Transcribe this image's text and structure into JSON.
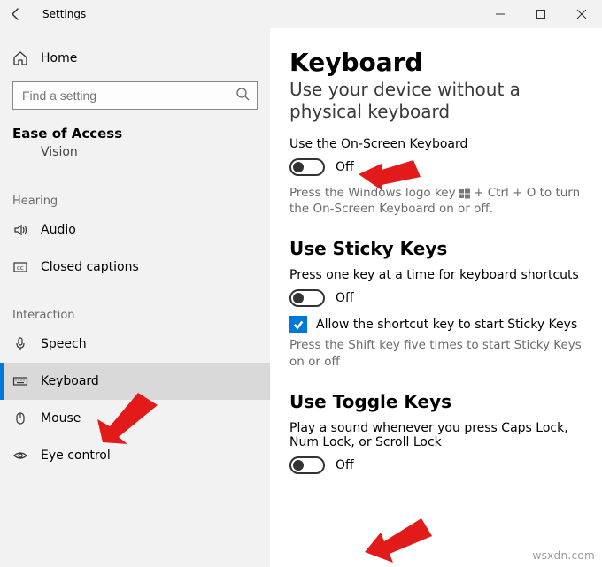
{
  "titlebar": {
    "title": "Settings"
  },
  "sidebar": {
    "home_label": "Home",
    "search_placeholder": "Find a setting",
    "section": "Ease of Access",
    "truncated_item": "Vision",
    "groups": [
      {
        "label": "Hearing",
        "items": [
          {
            "icon": "speaker",
            "label": "Audio"
          },
          {
            "icon": "cc",
            "label": "Closed captions"
          }
        ]
      },
      {
        "label": "Interaction",
        "items": [
          {
            "icon": "mic",
            "label": "Speech"
          },
          {
            "icon": "keyboard",
            "label": "Keyboard",
            "selected": true
          },
          {
            "icon": "mouse",
            "label": "Mouse"
          },
          {
            "icon": "eye",
            "label": "Eye control"
          }
        ]
      }
    ]
  },
  "main": {
    "heading": "Keyboard",
    "subtitle": "Use your device without a physical keyboard",
    "osk": {
      "label": "Use the On-Screen Keyboard",
      "state": "Off",
      "help_pre": "Press the Windows logo key ",
      "help_post": " + Ctrl + O to turn the On-Screen Keyboard on or off."
    },
    "sticky": {
      "heading": "Use Sticky Keys",
      "label": "Press one key at a time for keyboard shortcuts",
      "state": "Off",
      "checkbox_label": "Allow the shortcut key to start Sticky Keys",
      "help": "Press the Shift key five times to start Sticky Keys on or off"
    },
    "togglekeys": {
      "heading": "Use Toggle Keys",
      "label": "Play a sound whenever you press Caps Lock, Num Lock, or Scroll Lock",
      "state": "Off"
    }
  },
  "watermark": "wsxdn.com"
}
